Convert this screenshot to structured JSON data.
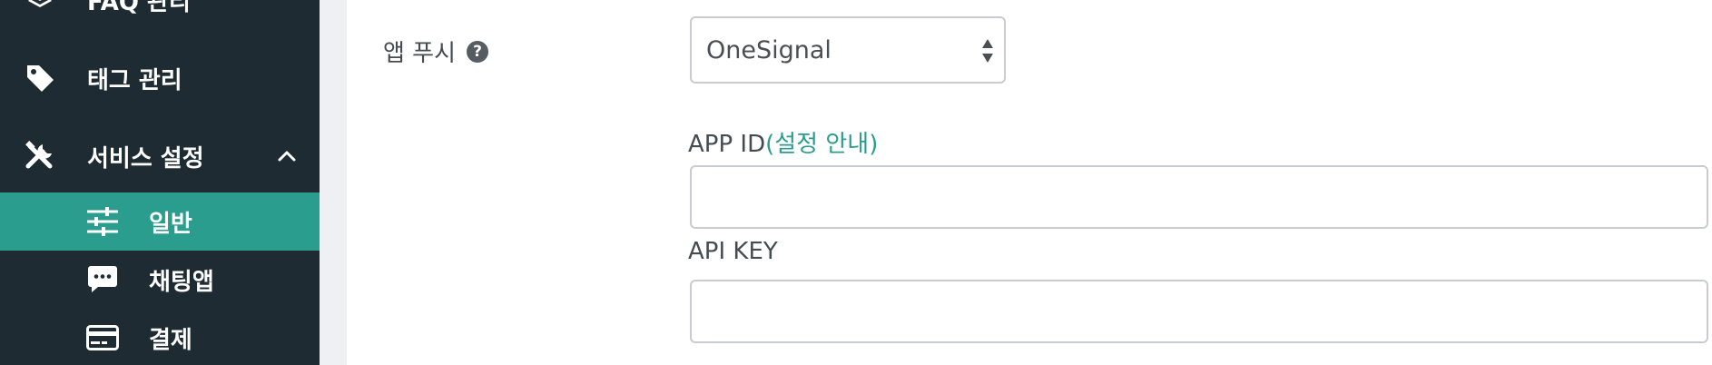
{
  "sidebar": {
    "items": [
      {
        "label": "FAQ 관리",
        "icon": "layers-icon"
      },
      {
        "label": "태그 관리",
        "icon": "tag-icon"
      },
      {
        "label": "서비스 설정",
        "icon": "tools-icon",
        "expanded": true
      }
    ],
    "sub_items": [
      {
        "label": "일반",
        "icon": "sliders-icon",
        "active": true
      },
      {
        "label": "채팅앱",
        "icon": "chat-bubble-icon"
      },
      {
        "label": "결제",
        "icon": "credit-card-icon"
      }
    ],
    "colors": {
      "background": "#1e2b33",
      "active": "#2a9d8f"
    }
  },
  "form": {
    "app_push": {
      "label": "앱 푸시",
      "help": "?",
      "selected": "OneSignal"
    },
    "app_id": {
      "label": "APP ID",
      "link": "(설정 안내)",
      "value": ""
    },
    "api_key": {
      "label": "API KEY",
      "value": ""
    }
  }
}
